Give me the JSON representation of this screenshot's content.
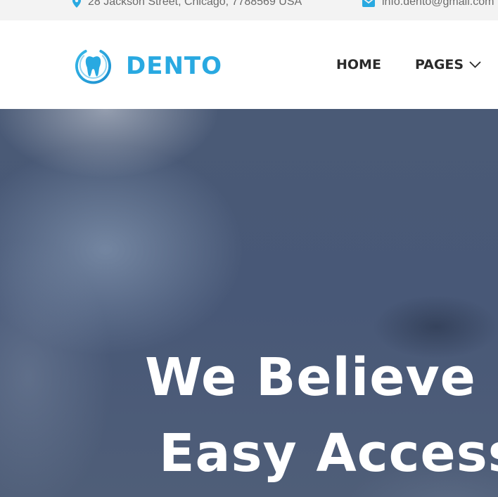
{
  "topbar": {
    "address": "28 Jackson Street, Chicago, 7788569 USA",
    "address_icon": "map-pin-icon",
    "email": "info.dento@gmail.com",
    "email_icon": "envelope-icon",
    "icon_color": "#29a9e1"
  },
  "header": {
    "logo_text": "DENTO",
    "logo_icon": "tooth-icon",
    "brand_color": "#29a9e1",
    "nav": [
      {
        "label": "HOME"
      },
      {
        "label": "PAGES",
        "icon": "chevron-down-icon"
      }
    ]
  },
  "hero": {
    "title_line1": "We Believe Everyone",
    "title_line2": "Easy Access to Care"
  }
}
